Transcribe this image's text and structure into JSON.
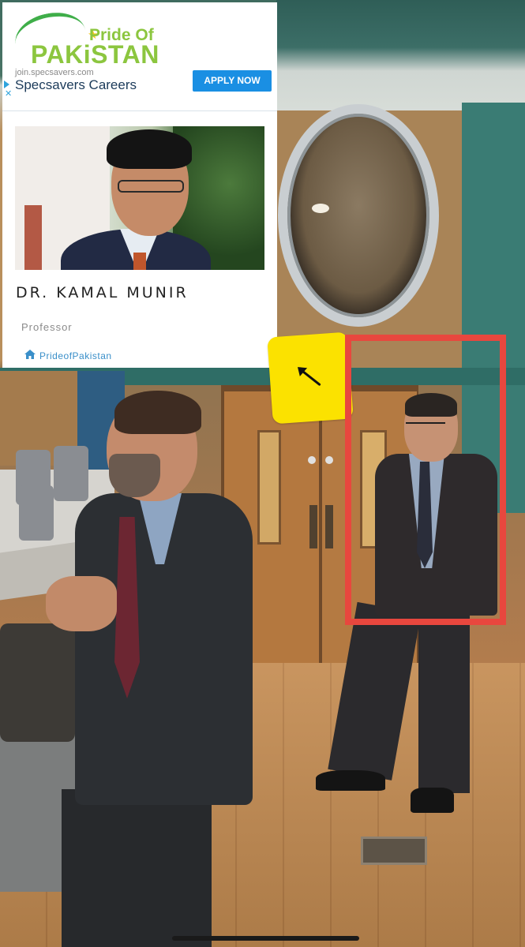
{
  "ad": {
    "logo_line1": "Pride Of",
    "logo_line2": "PAKiSTAN",
    "domain": "join.specsavers.com",
    "headline": "Specsavers Careers",
    "cta_label": "APPLY NOW",
    "adchoices_close": "✕"
  },
  "profile": {
    "name": "DR. KAMAL MUNIR",
    "role": "Professor",
    "link_label": "PrideofPakistan"
  },
  "colors": {
    "logo_green": "#8cc63f",
    "cta_blue": "#1a8fe3",
    "link_blue": "#3a8fc9",
    "sticky_yellow": "#fbe200",
    "highlight_red": "#e8473e"
  },
  "icons": {
    "home": "home-icon",
    "adchoices": "adchoices-icon",
    "arrow": "arrow-up-left-icon"
  }
}
